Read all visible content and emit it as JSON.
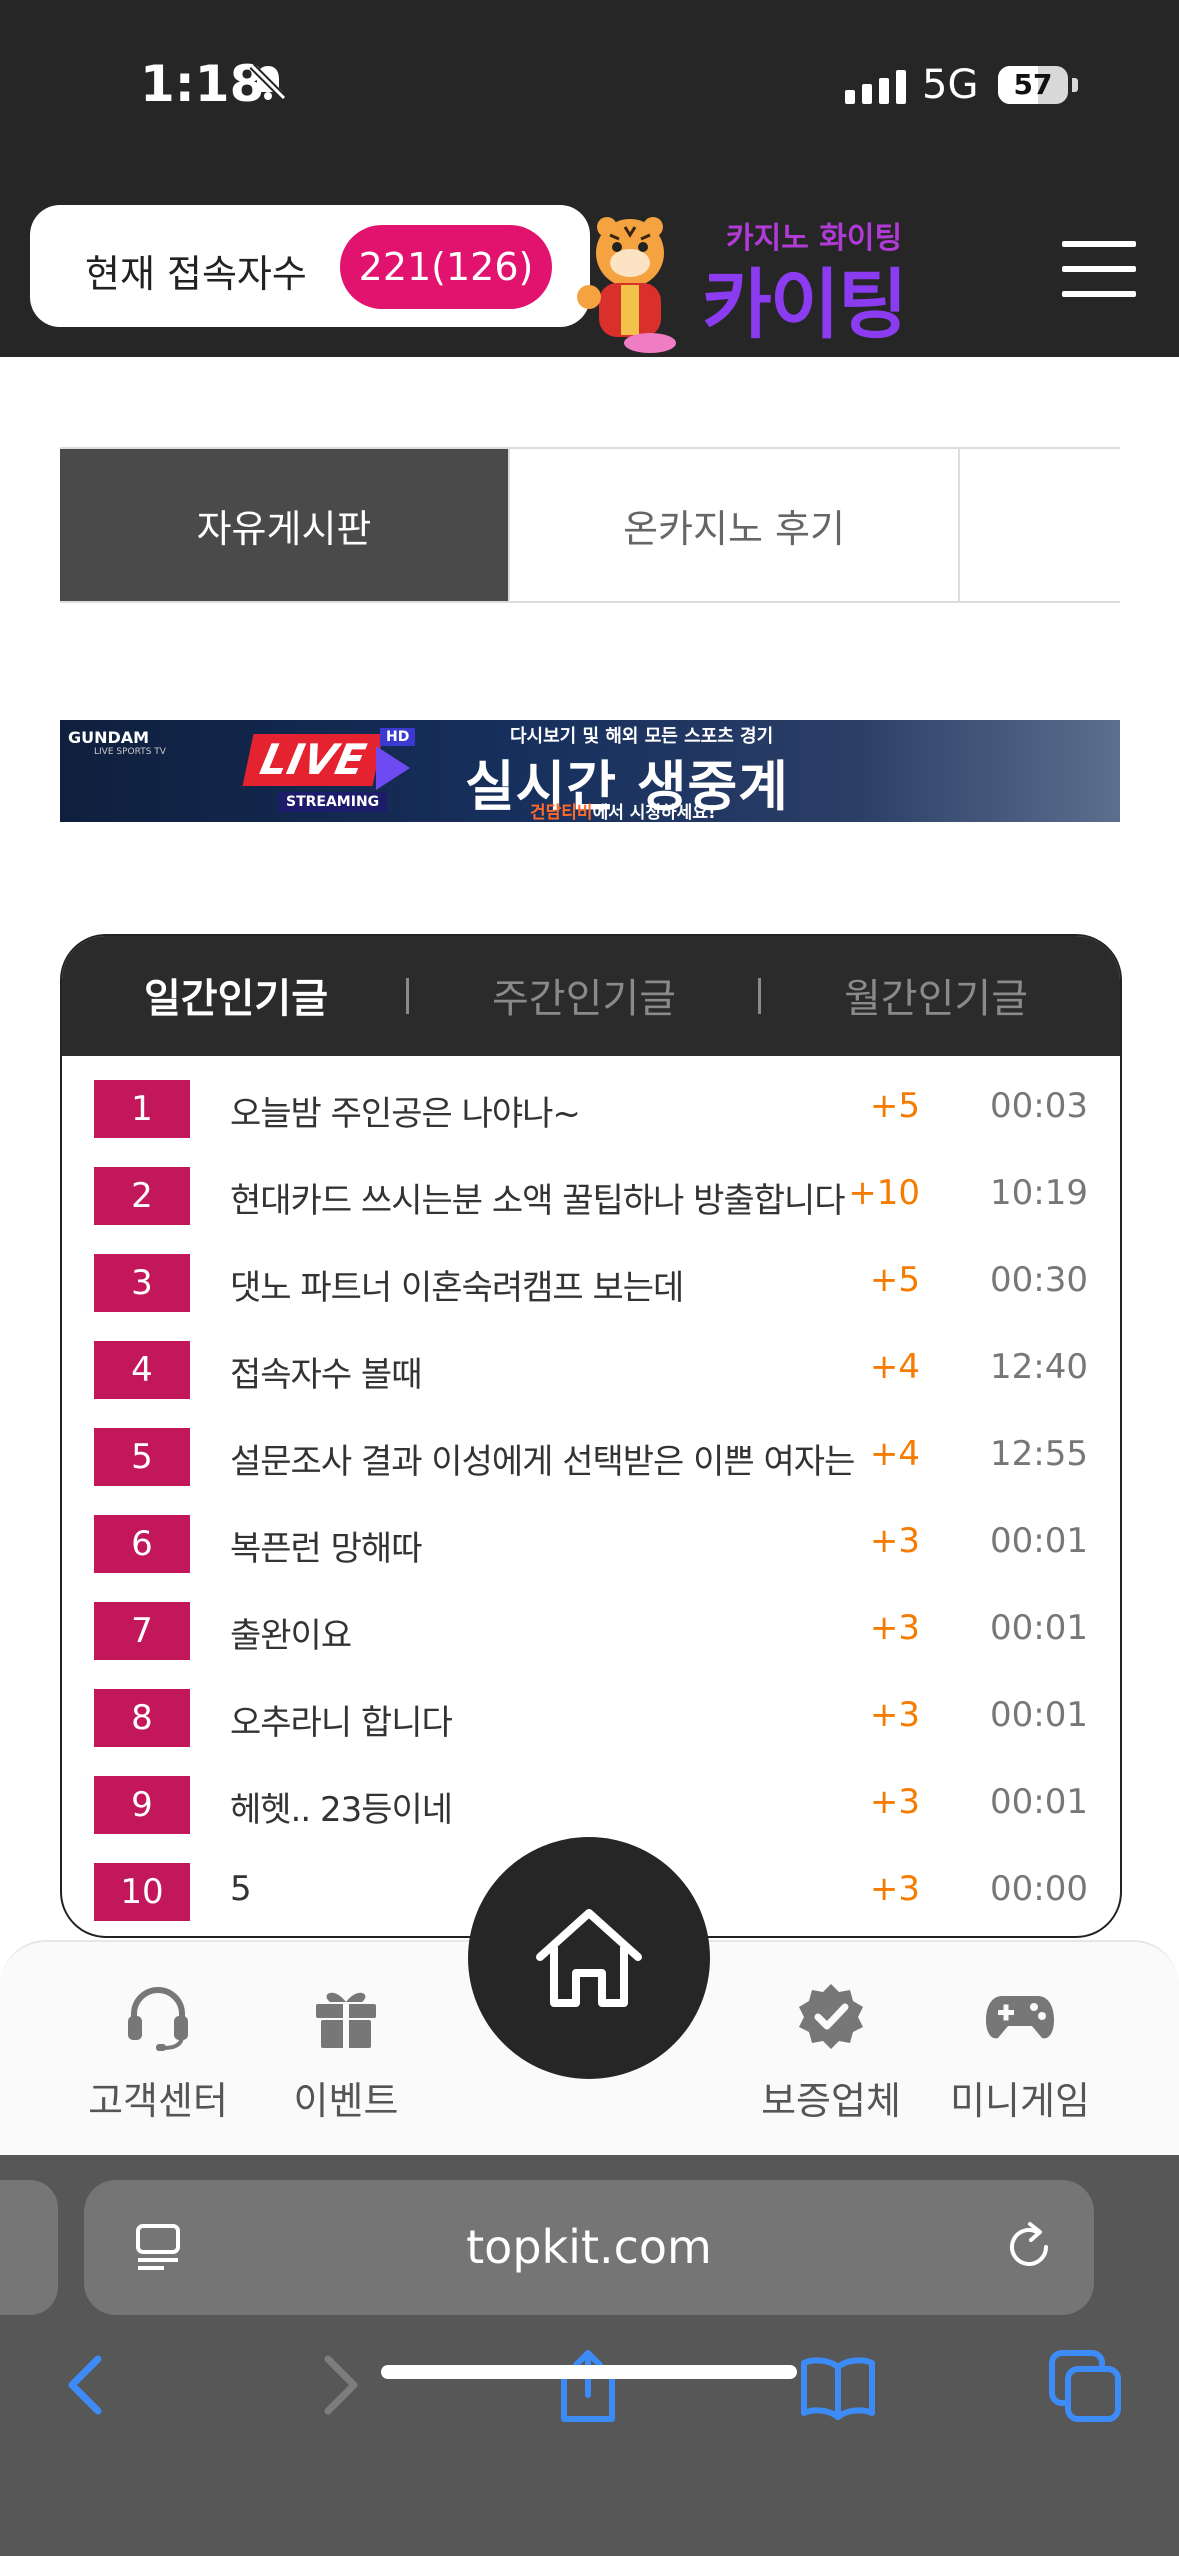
{
  "status_bar": {
    "time": "1:18",
    "network": "5G",
    "battery": "57",
    "battery_level": 0.57
  },
  "header": {
    "connection_label": "현재 접속자수",
    "connection_count": "221(126)",
    "logo_top": "카지노 화이팅",
    "logo_main": "카이팅"
  },
  "board_tabs": [
    {
      "label": "자유게시판",
      "active": true
    },
    {
      "label": "온카지노 후기",
      "active": false
    },
    {
      "label": "",
      "active": false
    }
  ],
  "banner": {
    "brand": "GUNDAM",
    "brand_sub": "LIVE SPORTS TV",
    "live": "LIVE",
    "hd": "HD",
    "streaming": "STREAMING",
    "top_text": "다시보기 및 해외 모든 스포츠 경기",
    "main_text": "실시간 생중계",
    "bottom_highlight": "건담티비",
    "bottom_rest": "에서 시청하세요!"
  },
  "popular": {
    "tabs": [
      "일간인기글",
      "주간인기글",
      "월간인기글"
    ],
    "active_tab": 0,
    "posts": [
      {
        "rank": "1",
        "title": "오늘밤 주인공은 나야나~",
        "votes": "+5",
        "time": "00:03"
      },
      {
        "rank": "2",
        "title": "현대카드 쓰시는분 소액 꿀팁하나 방출합니다",
        "votes": "+10",
        "time": "10:19"
      },
      {
        "rank": "3",
        "title": "댓노 파트너 이혼숙려캠프 보는데",
        "votes": "+5",
        "time": "00:30"
      },
      {
        "rank": "4",
        "title": "접속자수 볼때",
        "votes": "+4",
        "time": "12:40"
      },
      {
        "rank": "5",
        "title": "설문조사 결과 이성에게 선택받은 이쁜 여자는",
        "votes": "+4",
        "time": "12:55"
      },
      {
        "rank": "6",
        "title": "복픈런 망해따",
        "votes": "+3",
        "time": "00:01"
      },
      {
        "rank": "7",
        "title": "출완이요",
        "votes": "+3",
        "time": "00:01"
      },
      {
        "rank": "8",
        "title": "오추라니 합니다",
        "votes": "+3",
        "time": "00:01"
      },
      {
        "rank": "9",
        "title": "헤헷.. 23등이네",
        "votes": "+3",
        "time": "00:01"
      },
      {
        "rank": "10",
        "title": "5",
        "votes": "+3",
        "time": "00:00"
      }
    ]
  },
  "bottom_nav": {
    "items": [
      {
        "label": "고객센터",
        "icon": "headset-icon"
      },
      {
        "label": "이벤트",
        "icon": "gift-icon"
      },
      {
        "label": "보증업체",
        "icon": "verified-badge-icon"
      },
      {
        "label": "미니게임",
        "icon": "gamepad-icon"
      }
    ],
    "home_icon": "home-icon"
  },
  "browser": {
    "url": "topkit.com",
    "toolbar": [
      "back-icon",
      "forward-icon",
      "share-icon",
      "bookmarks-icon",
      "tabs-icon"
    ]
  },
  "colors": {
    "header_bg": "#262626",
    "accent_pink": "#e1136f",
    "rank_badge": "#c2185b",
    "vote_orange": "#f57c00",
    "safari_blue": "#3d8bf7"
  }
}
